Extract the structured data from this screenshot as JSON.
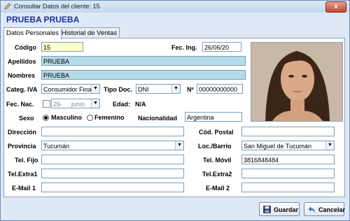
{
  "window": {
    "title": "Consultar Datos del cliente: 15",
    "close_label": "x"
  },
  "client_name": "PRUEBA PRUEBA",
  "tabs": [
    {
      "label": "Datos Personales",
      "active": true
    },
    {
      "label": "Historial de Ventas",
      "active": false
    }
  ],
  "form": {
    "codigo": {
      "label": "Código",
      "value": "15"
    },
    "fec_ing": {
      "label": "Fec. Ing.",
      "value": "26/06/20"
    },
    "apellidos": {
      "label": "Apellidos",
      "value": "PRUEBA"
    },
    "nombres": {
      "label": "Nombres",
      "value": "PRUEBA"
    },
    "categ_iva": {
      "label": "Categ. IVA",
      "value": "Consumidor Final"
    },
    "tipo_doc": {
      "label": "Tipo Doc.",
      "value": "DNI"
    },
    "numero": {
      "label": "Nº",
      "value": "00000000000"
    },
    "fec_nac": {
      "label": "Fec. Nac.",
      "day": "26-",
      "month": "junio"
    },
    "edad": {
      "label": "Edad:",
      "value": "N/A"
    },
    "sexo": {
      "label": "Sexo",
      "option_m": "Masculino",
      "option_f": "Femenino",
      "selected": "Masculino"
    },
    "nacionalidad": {
      "label": "Nacionalidad",
      "value": "Argentina"
    },
    "direccion": {
      "label": "Dirección",
      "value": ""
    },
    "cod_postal": {
      "label": "Cód. Postal",
      "value": ""
    },
    "provincia": {
      "label": "Provincia",
      "value": "Tucumán"
    },
    "loc_barrio": {
      "label": "Loc./Barrio",
      "value": "San Miguel de Tucumán"
    },
    "tel_fijo": {
      "label": "Tel. Fijo",
      "value": ""
    },
    "tel_movil": {
      "label": "Tel. Móvil",
      "value": "3816848484"
    },
    "tel_extra1": {
      "label": "Tel.Extra1",
      "value": ""
    },
    "tel_extra2": {
      "label": "Tel.Extra2",
      "value": ""
    },
    "email1": {
      "label": "E-Mail 1",
      "value": ""
    },
    "email2": {
      "label": "E-Mail 2",
      "value": ""
    }
  },
  "buttons": {
    "guardar": "Guardar",
    "cancelar": "Cancelar"
  },
  "colors": {
    "title_text": "#1c2f9e",
    "highlight_field": "#b6dbe8",
    "code_field": "#ffffcc"
  }
}
